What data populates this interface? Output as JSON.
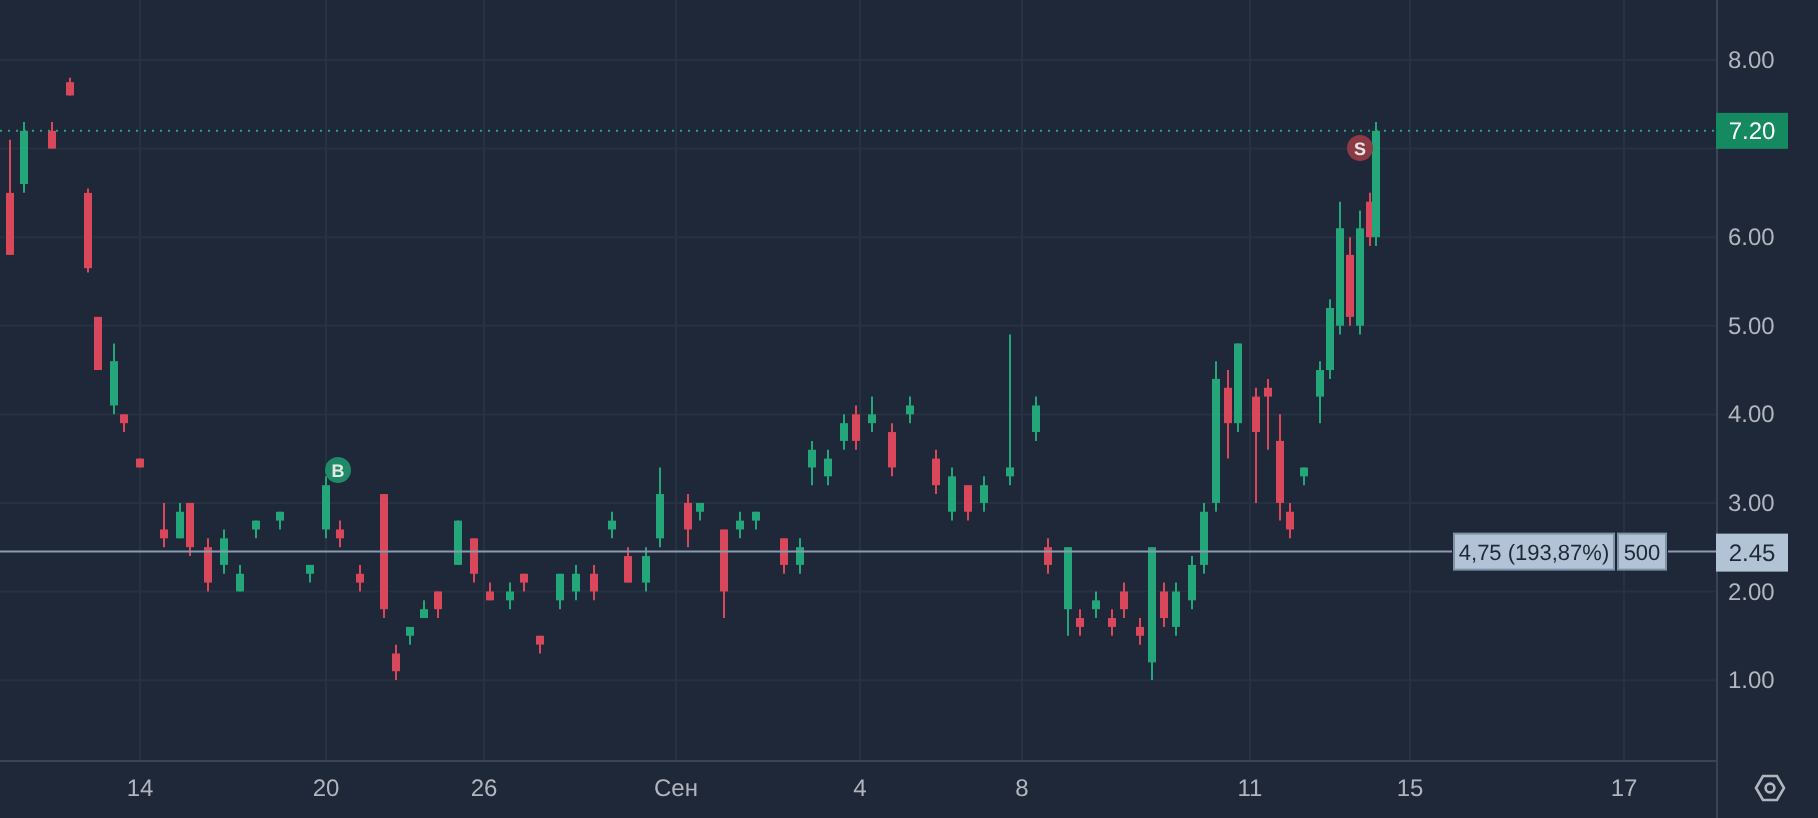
{
  "chart": {
    "price_axis": [
      "8.00",
      "6.00",
      "5.00",
      "4.00",
      "3.00",
      "2.00",
      "1.00"
    ],
    "time_axis": [
      "14",
      "20",
      "26",
      "Сен",
      "4",
      "8",
      "11",
      "15",
      "17"
    ],
    "last_price": "7.20",
    "position": {
      "label": "4,75 (193,87%)",
      "quantity": "500",
      "price": "2.45"
    },
    "markers": [
      {
        "kind": "buy",
        "label": "B",
        "color": "#1f8a68"
      },
      {
        "kind": "sell",
        "label": "S",
        "color": "#8c3a44"
      }
    ]
  }
}
